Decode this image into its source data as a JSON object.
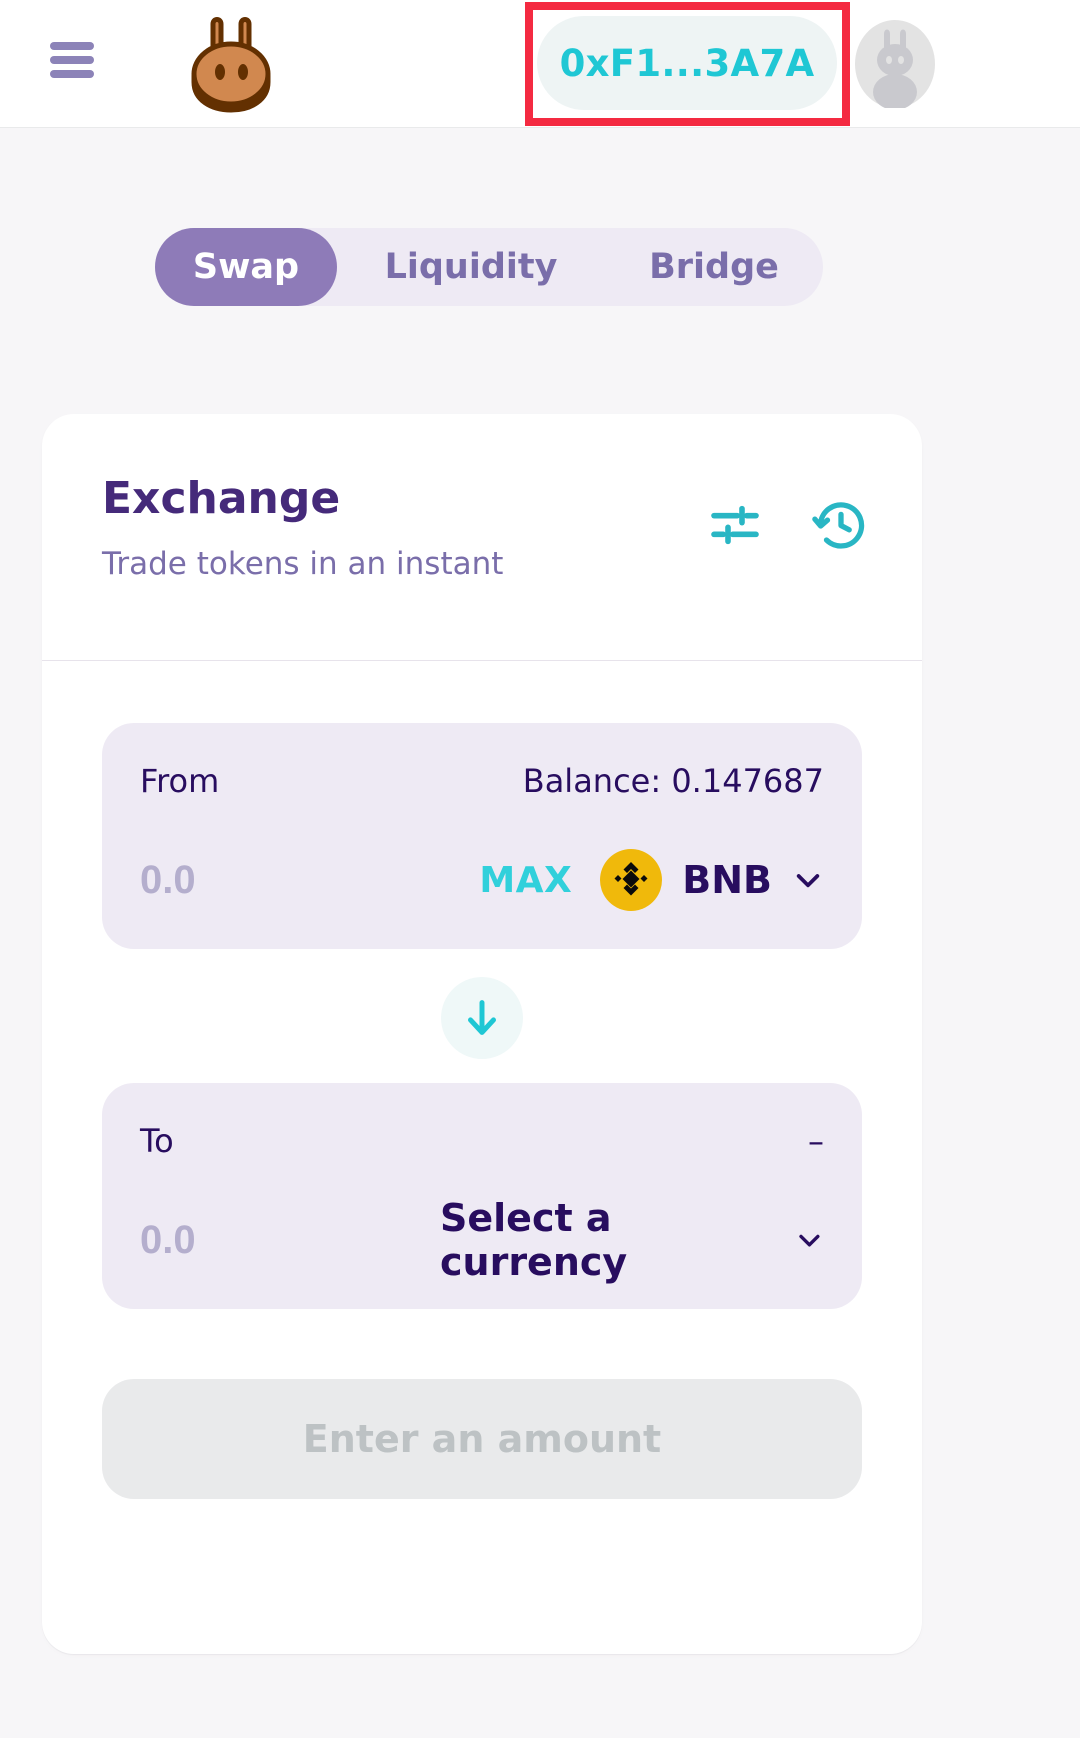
{
  "header": {
    "menu_icon": "hamburger-menu-icon",
    "logo_icon": "pancakeswap-bunny-logo",
    "wallet_address": "0xF1...3A7A",
    "avatar_icon": "user-avatar-bunny-icon",
    "highlight_color": "#F42A41",
    "wallet_text_color": "#1FC7D4"
  },
  "tabs": [
    {
      "label": "Swap",
      "active": true
    },
    {
      "label": "Liquidity",
      "active": false
    },
    {
      "label": "Bridge",
      "active": false
    }
  ],
  "card": {
    "title": "Exchange",
    "subtitle": "Trade tokens in an instant",
    "settings_icon": "settings-sliders-icon",
    "history_icon": "history-clock-icon"
  },
  "from_panel": {
    "label": "From",
    "balance": "Balance: 0.147687",
    "amount": "0.0",
    "amount_placeholder": "0.0",
    "max_label": "MAX",
    "token_symbol": "BNB",
    "token_icon": "binance-bnb-logo",
    "chevron_icon": "chevron-down-icon"
  },
  "swap_button": {
    "icon": "arrow-down-icon"
  },
  "to_panel": {
    "label": "To",
    "balance": "–",
    "amount": "0.0",
    "amount_placeholder": "0.0",
    "select_label": "Select a currency",
    "chevron_icon": "chevron-down-icon"
  },
  "cta": {
    "label": "Enter an amount",
    "disabled": true
  },
  "colors": {
    "primary": "#1FC7D4",
    "text_dark": "#280D5F",
    "text_purple": "#7A6EAA",
    "title_purple": "#452A7A",
    "panel_bg": "#EEEAF4",
    "page_bg": "#F7F6F8",
    "tab_active_bg": "#8E7BB8"
  }
}
